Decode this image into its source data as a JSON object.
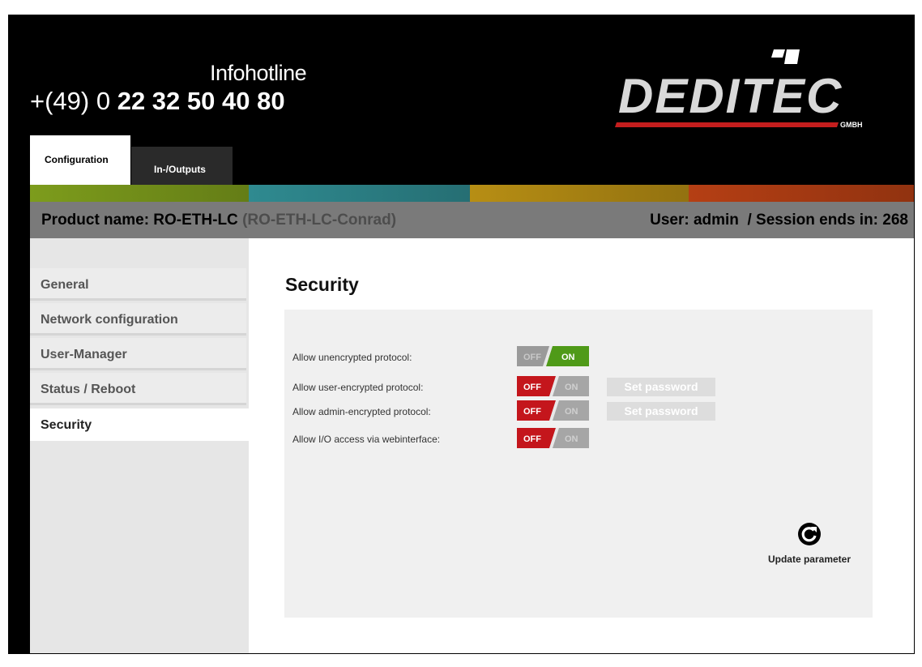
{
  "header": {
    "hotline_label": "Infohotline",
    "hotline_prefix": "+(49) 0 ",
    "hotline_number": "22 32 50 40 80",
    "logo_text": "DEDITEC",
    "logo_suffix": "GMBH"
  },
  "tabs": [
    {
      "label": "Configuration",
      "active": true
    },
    {
      "label": "In-/Outputs",
      "active": false
    }
  ],
  "stripe_colors": [
    "#7d9c1c",
    "#2f8a90",
    "#b78e14",
    "#b53f14"
  ],
  "product_bar": {
    "label": "Product name: RO-ETH-LC",
    "sub": "(RO-ETH-LC-Conrad)",
    "user_info": "User: admin  / Session ends in: 268"
  },
  "sidebar": {
    "items": [
      {
        "label": "General",
        "active": false
      },
      {
        "label": "Network configuration",
        "active": false
      },
      {
        "label": "User-Manager",
        "active": false
      },
      {
        "label": "Status / Reboot",
        "active": false
      },
      {
        "label": "Security",
        "active": true
      }
    ]
  },
  "main": {
    "title": "Security",
    "toggle_off": "OFF",
    "toggle_on": "ON",
    "settings": [
      {
        "label": "Allow unencrypted protocol:",
        "state": "on",
        "button": null
      },
      {
        "label": "Allow user-encrypted protocol:",
        "state": "off",
        "button": "Set password"
      },
      {
        "label": "Allow admin-encrypted protocol:",
        "state": "off",
        "button": "Set password"
      },
      {
        "label": "Allow I/O access via webinterface:",
        "state": "off",
        "button": null
      }
    ],
    "update_label": "Update parameter"
  }
}
